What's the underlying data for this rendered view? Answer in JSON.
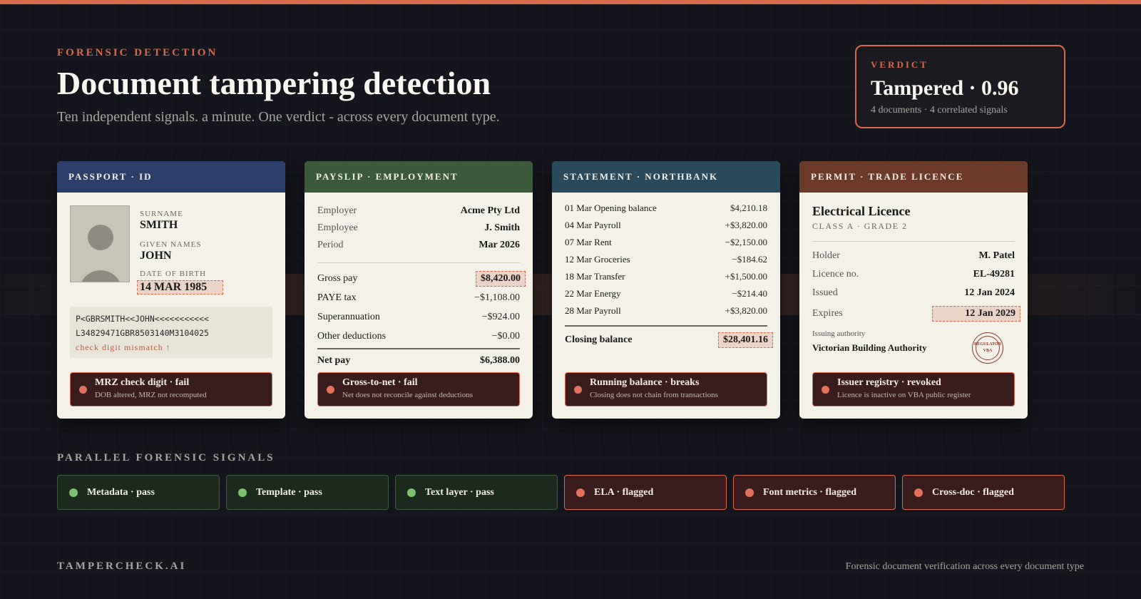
{
  "header": {
    "eyebrow": "FORENSIC DETECTION",
    "title": "Document tampering detection",
    "subtitle": "Ten independent signals. a minute. One verdict - across every document type."
  },
  "verdict": {
    "label": "VERDICT",
    "value": "Tampered · 0.96",
    "summary": "4 documents · 4 correlated signals"
  },
  "colors": {
    "accent": "#d9694a",
    "passport_header": "#2c3f6b",
    "payslip_header": "#3b5a3a",
    "statement_header": "#284a5c",
    "permit_header": "#6b3a28",
    "pass": "#7cc16e",
    "flag": "#e2735a"
  },
  "passport": {
    "header": "PASSPORT · ID",
    "photo_icon": "person-silhouette-icon",
    "surname_label": "SURNAME",
    "surname": "SMITH",
    "given_label": "GIVEN NAMES",
    "given": "JOHN",
    "dob_label": "DATE OF BIRTH",
    "dob": "14 MAR 1985",
    "mrz_line1": "P<GBRSMITH<<JOHN<<<<<<<<<<<",
    "mrz_line2": "L34829471GBR8503140M3104025",
    "mrz_warning": "check digit mismatch ↑",
    "alert_title": "MRZ check digit · fail",
    "alert_sub": "DOB altered, MRZ not recomputed"
  },
  "payslip": {
    "header": "PAYSLIP · EMPLOYMENT",
    "employer_label": "Employer",
    "employer": "Acme Pty Ltd",
    "employee_label": "Employee",
    "employee": "J. Smith",
    "period_label": "Period",
    "period": "Mar 2026",
    "gross_label": "Gross pay",
    "gross": "$8,420.00",
    "paye_label": "PAYE tax",
    "paye": "−$1,108.00",
    "super_label": "Superannuation",
    "super": "−$924.00",
    "other_label": "Other deductions",
    "other": "−$0.00",
    "net_label": "Net pay",
    "net": "$6,388.00",
    "alert_title": "Gross-to-net · fail",
    "alert_sub": "Net does not reconcile against deductions"
  },
  "statement": {
    "header": "STATEMENT · NORTHBANK",
    "rows": [
      {
        "label": "01 Mar Opening balance",
        "value": "$4,210.18"
      },
      {
        "label": "04 Mar Payroll",
        "value": "+$3,820.00"
      },
      {
        "label": "07 Mar Rent",
        "value": "−$2,150.00"
      },
      {
        "label": "12 Mar Groceries",
        "value": "−$184.62"
      },
      {
        "label": "18 Mar Transfer",
        "value": "+$1,500.00"
      },
      {
        "label": "22 Mar Energy",
        "value": "−$214.40"
      },
      {
        "label": "28 Mar Payroll",
        "value": "+$3,820.00"
      }
    ],
    "closing_label": "Closing balance",
    "closing": "$28,401.16",
    "alert_title": "Running balance · breaks",
    "alert_sub": "Closing does not chain from transactions"
  },
  "permit": {
    "header": "PERMIT · TRADE LICENCE",
    "title": "Electrical Licence",
    "class": "CLASS A · GRADE 2",
    "holder_label": "Holder",
    "holder": "M. Patel",
    "licence_label": "Licence no.",
    "licence": "EL-49281",
    "issued_label": "Issued",
    "issued": "12 Jan 2024",
    "expires_label": "Expires",
    "expires": "12 Jan 2029",
    "authority_label": "Issuing authority",
    "authority": "Victorian Building Authority",
    "seal_top": "REGULATOR",
    "seal_bottom": "VBA",
    "alert_title": "Issuer registry · revoked",
    "alert_sub": "Licence is inactive on VBA public register"
  },
  "signals": {
    "title": "PARALLEL FORENSIC SIGNALS",
    "items": [
      {
        "label": "Metadata · pass",
        "status": "pass"
      },
      {
        "label": "Template · pass",
        "status": "pass"
      },
      {
        "label": "Text layer · pass",
        "status": "pass"
      },
      {
        "label": "ELA · flagged",
        "status": "flagged"
      },
      {
        "label": "Font metrics · flagged",
        "status": "flagged"
      },
      {
        "label": "Cross-doc · flagged",
        "status": "flagged"
      }
    ]
  },
  "footer": {
    "brand": "TAMPERCHECK.AI",
    "tagline": "Forensic document verification across every document type"
  }
}
